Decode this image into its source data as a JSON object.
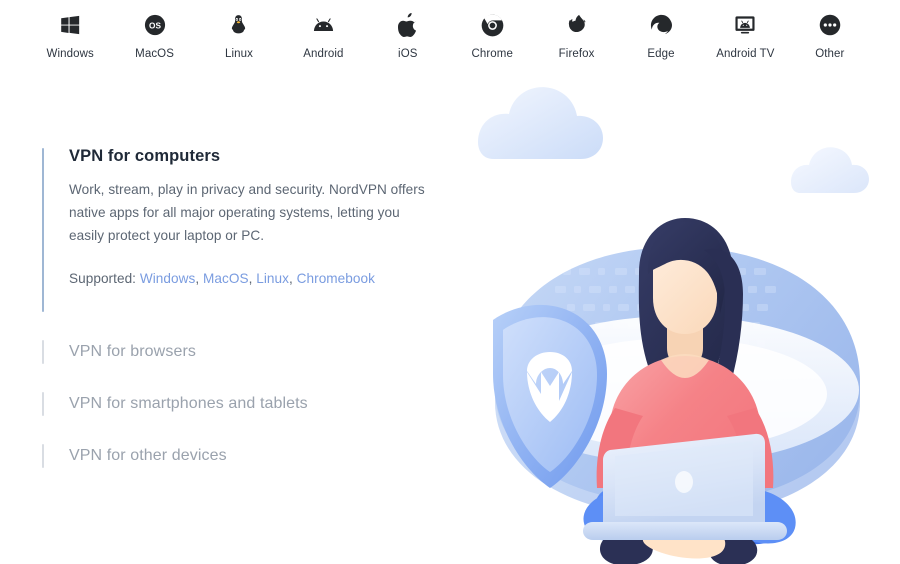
{
  "platforms": [
    {
      "label": "Windows",
      "icon": "windows-icon"
    },
    {
      "label": "MacOS",
      "icon": "macos-icon"
    },
    {
      "label": "Linux",
      "icon": "linux-icon"
    },
    {
      "label": "Android",
      "icon": "android-icon"
    },
    {
      "label": "iOS",
      "icon": "ios-icon"
    },
    {
      "label": "Chrome",
      "icon": "chrome-icon"
    },
    {
      "label": "Firefox",
      "icon": "firefox-icon"
    },
    {
      "label": "Edge",
      "icon": "edge-icon"
    },
    {
      "label": "Android TV",
      "icon": "android-tv-icon"
    },
    {
      "label": "Other",
      "icon": "other-ellipsis-icon"
    }
  ],
  "accordion": {
    "items": [
      {
        "title": "VPN for computers",
        "expanded": true,
        "description": "Work, stream, play in privacy and security. NordVPN offers native apps for all major operating systems, letting you easily protect your laptop or PC.",
        "supported_label": "Supported:",
        "supported_links": [
          "Windows",
          "MacOS",
          "Linux",
          "Chromebook"
        ]
      },
      {
        "title": "VPN for browsers",
        "expanded": false
      },
      {
        "title": "VPN for smartphones and tablets",
        "expanded": false
      },
      {
        "title": "VPN for other devices",
        "expanded": false
      }
    ]
  },
  "illustration": {
    "name": "woman-with-laptop-and-shield",
    "elements": [
      "cloud-large",
      "cloud-small",
      "backdrop-ellipse",
      "nordvpn-shield",
      "woman-seated",
      "laptop"
    ],
    "colors": {
      "cloud": "#e4ecfb",
      "backdrop_blue": "#a8c4ee",
      "backdrop_light": "#e8f0fd",
      "shield_blue": "#8fb4f2",
      "hair_navy": "#2b3055",
      "skin": "#fde4ce",
      "sweater_pink": "#f4868f",
      "jeans_blue": "#4a80f0",
      "laptop_grey": "#d7e2f5",
      "sock_navy": "#2b3055"
    }
  },
  "theme": {
    "accent_active_bar": "#9fb7d4",
    "inactive_bar": "#d9dde3",
    "link_color": "#7a9ce0",
    "heading_color": "#1f2937",
    "body_color": "#5c6673",
    "muted_title": "#9aa2ad",
    "background": "#ffffff"
  }
}
